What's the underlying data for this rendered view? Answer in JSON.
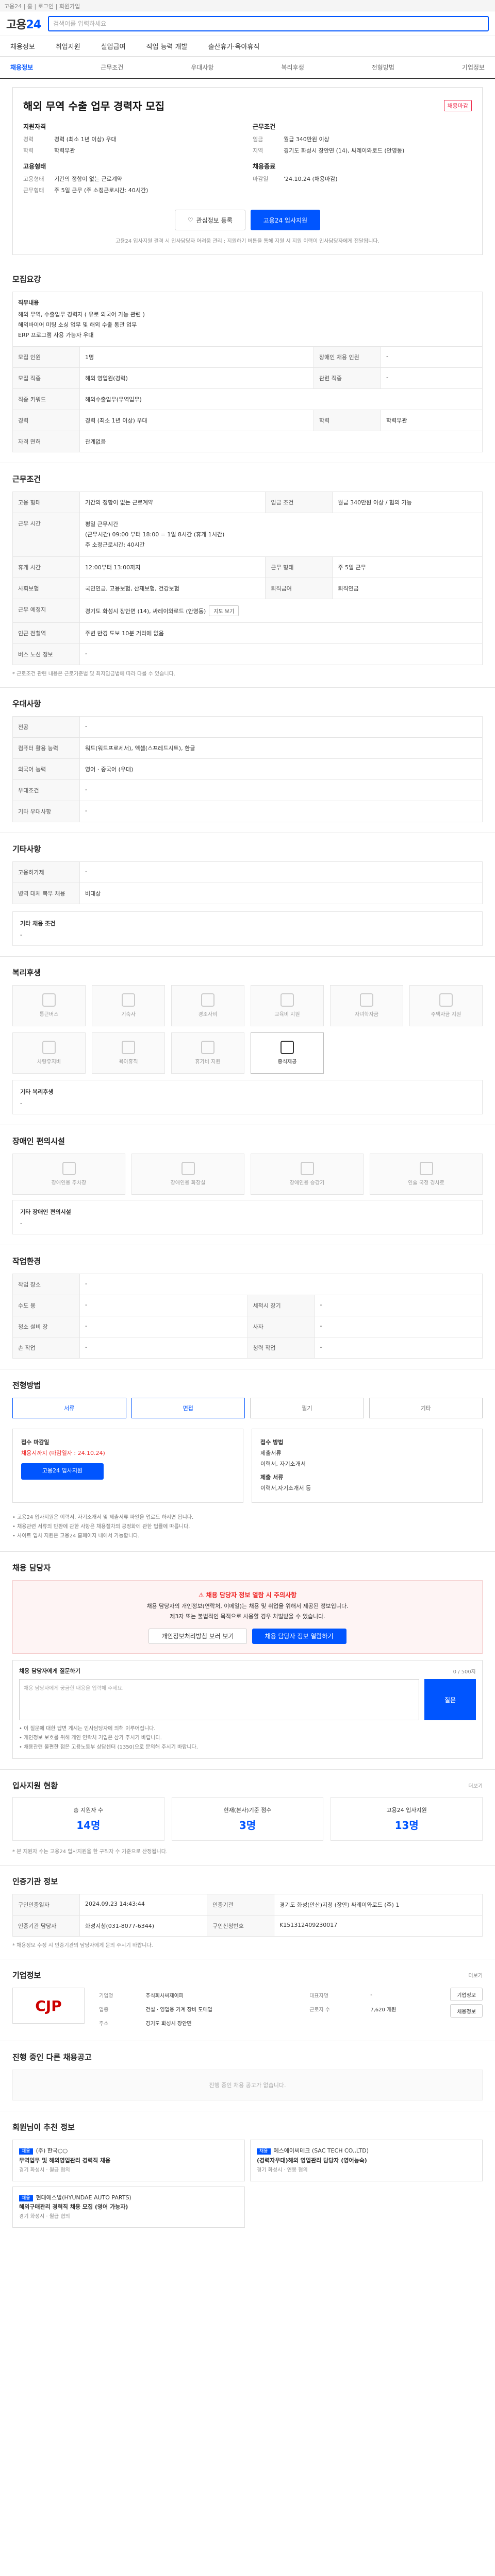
{
  "topbar": {
    "text": "고용24 | 홈 | 로그인 | 회원가입"
  },
  "header": {
    "logo_main": "고용",
    "logo_num": "24",
    "search_placeholder": "검색어를 입력하세요"
  },
  "nav": [
    "채용정보",
    "취업지원",
    "실업급여",
    "직업 능력 개발",
    "출산휴가·육아휴직"
  ],
  "subnav": [
    "채용정보",
    "근무조건",
    "우대사항",
    "복리후생",
    "전형방법",
    "기업정보"
  ],
  "job": {
    "title": "해외 무역 수출 업무 경력자 모집",
    "tag": "채용마감",
    "left_title": "지원자격",
    "left": [
      {
        "k": "경력",
        "v": "경력 (최소 1년 이상) 우대"
      },
      {
        "k": "학력",
        "v": "학력무관"
      }
    ],
    "left2_title": "고용형태",
    "left2": [
      {
        "k": "고용형태",
        "v": "기간의 정함이 없는 근로계약"
      },
      {
        "k": "근무형태",
        "v": "주 5일 근무 (주 소정근로시간: 40시간)"
      }
    ],
    "right_title": "근무조건",
    "right": [
      {
        "k": "임금",
        "v": "월급 340만원 이상"
      },
      {
        "k": "지역",
        "v": "경기도 화성시 장안면 (14), 싸레이와로드 (안영동)"
      }
    ],
    "right2_title": "채용종료",
    "right2": [
      {
        "k": "마감일",
        "v": "'24.10.24 (채용마감)"
      }
    ],
    "btn_share": "관심정보 등록",
    "btn_apply": "고용24 입사지원",
    "note": "고용24 입사지원 결격 시 인사담당자 어려움 관리 : 지원하기 버튼을 통해 지원 시 지원 이력이 인사담당자에게 전달됩니다."
  },
  "recruit": {
    "title": "모집요강",
    "subtitle": "직무내용",
    "desc": "해외 무역, 수출입무 경력자 ( 유로 외국어 가능 관련 )\n해외바이어 미팅 소싱 업무 및 해외 수출 통관 업무\nERP 프로그램 사용 가능자 우대",
    "rows": [
      [
        {
          "k": "모집 인원",
          "v": "1명"
        },
        {
          "k": "장애인 채용 인원",
          "v": "-"
        }
      ],
      [
        {
          "k": "모집 직종",
          "v": "해외 영업원(경력)"
        },
        {
          "k": "관련 직종",
          "v": "-"
        }
      ],
      [
        {
          "k": "직종 키워드",
          "v": "해외수출입무(무역업무)"
        },
        {
          "k": "",
          "v": ""
        }
      ],
      [
        {
          "k": "경력",
          "v": "경력 (최소 1년 이상) 우대"
        },
        {
          "k": "학력",
          "v": "학력무관"
        }
      ],
      [
        {
          "k": "자격 면허",
          "v": "관계없음"
        },
        {
          "k": "",
          "v": ""
        }
      ]
    ]
  },
  "work": {
    "title": "근무조건",
    "rows": [
      [
        {
          "k": "고용 형태",
          "v": "기간의 정함이 없는 근로계약"
        },
        {
          "k": "임금 조건",
          "v": "월급 340만원 이상 / 협의 가능"
        }
      ],
      [
        {
          "k": "근무 시간",
          "v": "평일 근무시간\n(근무시간) 09:00 부터 18:00 = 1일 8시간 (휴게 1시간)\n주 소정근로시간: 40시간"
        },
        {
          "k": "",
          "v": ""
        }
      ],
      [
        {
          "k": "휴게 시간",
          "v": "12:00부터 13:00까지"
        },
        {
          "k": "근무 형태",
          "v": "주 5일 근무"
        }
      ],
      [
        {
          "k": "사회보험",
          "v": "국민연금, 고용보험, 산재보험, 건강보험"
        },
        {
          "k": "퇴직급여",
          "v": "퇴직연금"
        }
      ],
      [
        {
          "k": "근무 예정지",
          "v": "경기도 화성시 장안면 (14), 싸레이와로드 (안영동)"
        },
        {
          "k": "",
          "v": ""
        }
      ],
      [
        {
          "k": "인근 전철역",
          "v": "주변 반경 도보 10분 거리에 없음"
        },
        {
          "k": "",
          "v": ""
        }
      ],
      [
        {
          "k": "버스 노선 정보",
          "v": "-"
        },
        {
          "k": "",
          "v": ""
        }
      ]
    ],
    "map_btn": "지도 보기",
    "note": "* 근로조건 관련 내용은 근로기준법 및 최저임금법에 따라 다를 수 있습니다."
  },
  "prefer": {
    "title": "우대사항",
    "rows": [
      [
        {
          "k": "전공",
          "v": "-"
        }
      ],
      [
        {
          "k": "컴퓨터 활용 능력",
          "v": "워드(워드프로세서), 엑셀(스프레드시트), 한글"
        }
      ],
      [
        {
          "k": "외국어 능력",
          "v": "영어 · 중국어 (우대)"
        }
      ],
      [
        {
          "k": "우대조건",
          "v": "-"
        }
      ],
      [
        {
          "k": "기타 우대사항",
          "v": "-"
        }
      ]
    ]
  },
  "extra": {
    "title": "기타사항",
    "rows": [
      [
        {
          "k": "고용허가제",
          "v": "-"
        }
      ],
      [
        {
          "k": "병역 대체 복무 채용",
          "v": "비대상"
        }
      ]
    ],
    "subtitle": "기타 채용 조건",
    "subtext": "-"
  },
  "welfare": {
    "title": "복리후생",
    "items": [
      "통근버스",
      "기숙사",
      "경조사비",
      "교육비 지원",
      "자녀학자금",
      "주택자금 지원",
      "차량유지비",
      "육아휴직",
      "휴가비 지원",
      "중식제공"
    ],
    "active": 9,
    "other_title": "기타 복리후생",
    "other_text": "-"
  },
  "facility": {
    "title": "장애인 편의시설",
    "items": [
      "장애인용 주차장",
      "장애인용 화장실",
      "장애인용 승강기",
      "인슐 국정 경사로"
    ],
    "other_title": "기타 장애인 편의시설",
    "other_text": "-"
  },
  "env": {
    "title": "작업환경",
    "rows": [
      [
        {
          "k": "작업 장소",
          "v": "-"
        },
        {
          "k": "",
          "v": ""
        }
      ],
      [
        {
          "k": "수도 용",
          "v": "-"
        },
        {
          "k": "세척시 장기",
          "v": "-"
        }
      ],
      [
        {
          "k": "청소 설비 장",
          "v": "-"
        },
        {
          "k": "사자",
          "v": "-"
        }
      ],
      [
        {
          "k": "손 작업",
          "v": "-"
        },
        {
          "k": "청력 작업",
          "v": "-"
        }
      ]
    ]
  },
  "process": {
    "title": "전형방법",
    "steps": [
      "서류",
      "면접",
      "필기",
      "기타"
    ],
    "on": [
      0,
      1
    ],
    "apply_left": [
      "접수 마감일",
      "채용시까지 (마감일자 : 24.10.24)",
      "고용24 입사지원"
    ],
    "apply_right": [
      "접수 방법",
      "제출서류",
      "이력서, 자기소개서",
      "제출 서류",
      "이력서,자기소개서 등"
    ],
    "notices": [
      "• 고용24 입사지원은 이력서, 자기소개서 및 제출서류 파일을 업로드 하시면 됩니다.",
      "• 채용관련 서류의 반환에 관한 사항은 채용절차의 공정화에 관한 법률에 따릅니다.",
      "• 사이트 입사 지원은 고용24 홈페이지 내에서 가능합니다."
    ]
  },
  "contact": {
    "title": "채용 담당자",
    "alert_title": "채용 담당자 정보 열람 시 주의사항",
    "alert_text": "채용 담당자의 개인정보(연락처, 이메일)는 채용 및 취업을 위해서 제공된 정보입니다.\n제3자 또는 불법적인 목적으로 사용할 경우 처벌받을 수 있습니다.",
    "btn1": "개인정보처리방침 보러 보기",
    "btn2": "채용 담당자 정보 열람하기",
    "q_title": "채용 담당자에게 질문하기",
    "q_placeholder": "채용 담당자에게 궁금한 내용을 입력해 주세요.",
    "q_btn": "질문",
    "q_count": "0 / 500자",
    "q_notes": [
      "• 이 질문에 대한 답변 게시는 인사담당자에 의해 이루어집니다.",
      "• 개인정보 보호를 위해 개인 연락처 기입은 삼가 주시기 바랍니다.",
      "• 채용관련 불편한 점은 고용노동부 상담센터 (1350)으로 문의해 주시기 바랍니다."
    ]
  },
  "applicants": {
    "title": "입사지원 현황",
    "more": "더보기",
    "stats": [
      {
        "label": "총 지원자 수",
        "v": "14명"
      },
      {
        "label": "현재(본사)기준 점수",
        "v": "3명"
      },
      {
        "label": "고용24 입사지원",
        "v": "13명"
      }
    ],
    "note": "* 본 지원자 수는 고용24 입사지원을 한 구직자 수 기준으로 산정됩니다."
  },
  "agency": {
    "title": "인증기관 정보",
    "rows": [
      [
        {
          "k": "구인인증일자",
          "v": "2024.09.23 14:43:44"
        },
        {
          "k": "인증기관",
          "v": "경기도 화성(안산)지청 (장안) 싸레이와로드 (주) 1"
        }
      ],
      [
        {
          "k": "인증기관 담당자",
          "v": "화성지청(031-8077-6344)"
        },
        {
          "k": "구인신청번호",
          "v": "K151312409230017"
        }
      ]
    ],
    "note": "* 채용정보 수정 시 인증기관의 담당자에게 문의 주시기 바랍니다."
  },
  "company": {
    "title": "기업정보",
    "logo": "CJP",
    "more": "더보기",
    "btn1": "기업정보",
    "btn2": "채용정보",
    "rows": [
      [
        {
          "k": "기업명",
          "v": "주식회사씨제이피"
        },
        {
          "k": "대표자명",
          "v": "-"
        }
      ],
      [
        {
          "k": "업종",
          "v": "건설 · 영업용 기계 장비 도매업"
        },
        {
          "k": "근로자 수",
          "v": "7,620 개원"
        }
      ],
      [
        {
          "k": "주소",
          "v": "경기도 화성시 장안면"
        },
        {
          "k": "",
          "v": ""
        }
      ]
    ]
  },
  "other_jobs": {
    "title": "진행 중인 다른 채용공고",
    "empty": "진행 중인 채용 공고가 없습니다."
  },
  "recommend": {
    "title": "회원님이 추천 정보",
    "items": [
      {
        "badge": "채용",
        "org": "(주) 한국○○",
        "title": "무역업무 및 해외영업관리 경력직 채용",
        "loc": "경기 화성시",
        "pay": "월급 협의"
      },
      {
        "badge": "채용",
        "org": "에스에이씨테크 (SAC TECH CO.,LTD)",
        "title": "(경력자우대)해외 영업관리 담당자 (영어능숙)",
        "loc": "경기 화성시",
        "pay": "연봉 협의"
      },
      {
        "badge": "채용",
        "org": "현대에스알(HYUNDAE AUTO PARTS)",
        "title": "해외구매관리 경력직 채용 모집 (영어 가능자)",
        "loc": "경기 화성시",
        "pay": "월급 협의"
      }
    ]
  }
}
